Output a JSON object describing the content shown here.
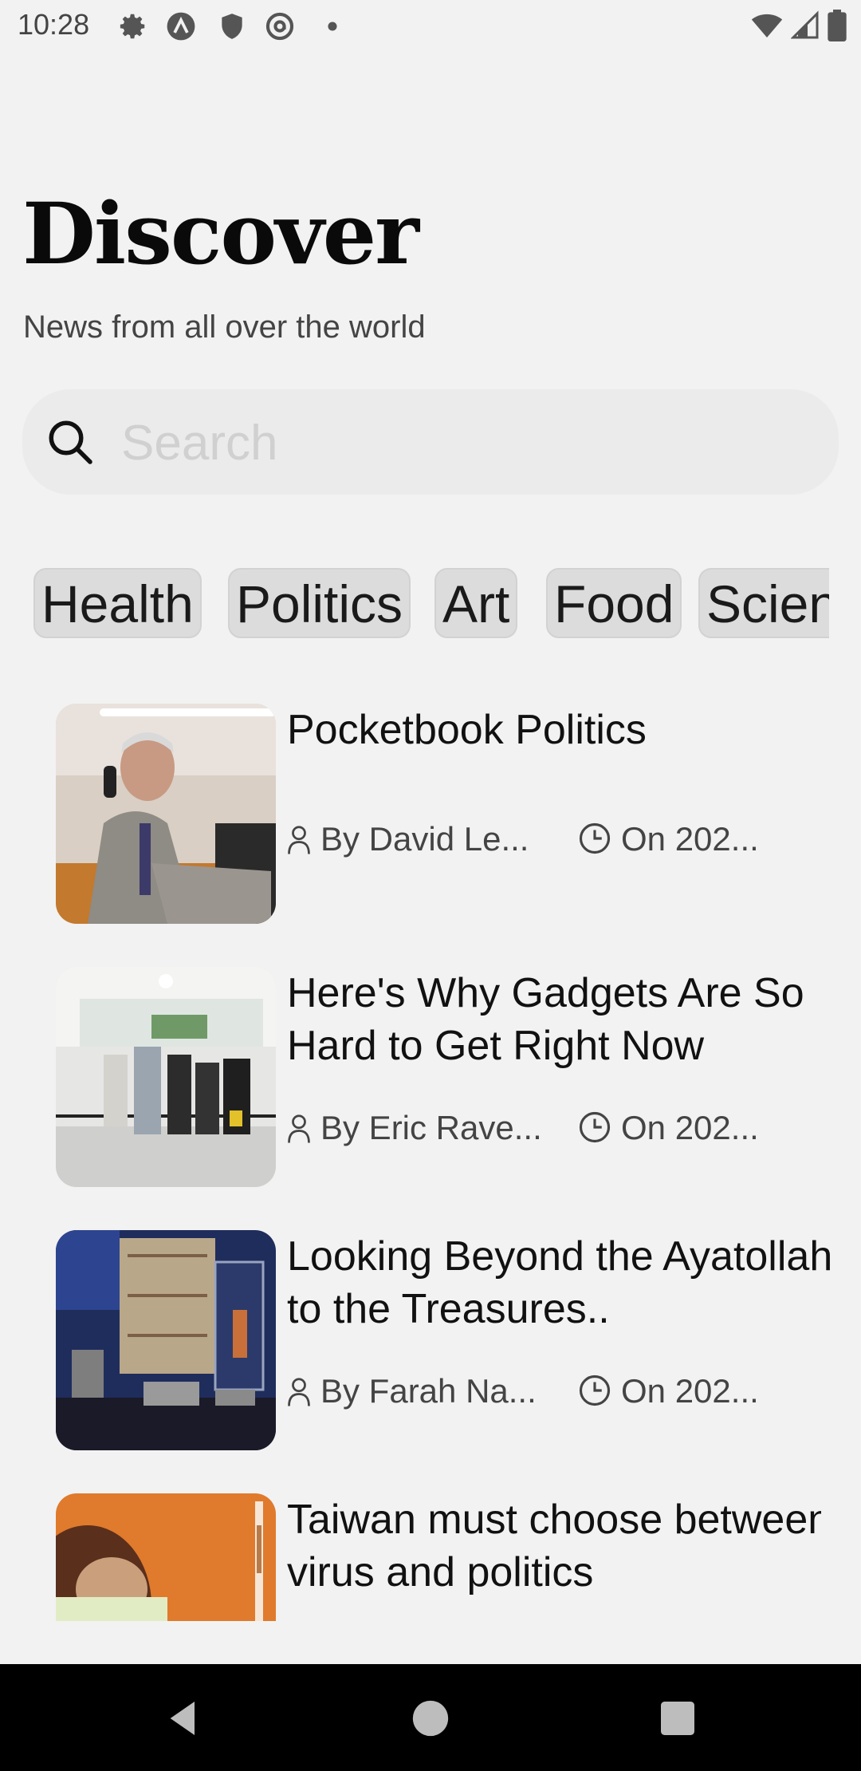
{
  "status_bar": {
    "time": "10:28",
    "left_icons": [
      "gear-icon",
      "app-a-icon",
      "shield-icon",
      "at-sign-icon",
      "dot-icon"
    ],
    "right_icons": [
      "wifi-icon",
      "cell-signal-icon",
      "battery-icon"
    ]
  },
  "header": {
    "title": "Discover",
    "subtitle": "News from all over the world"
  },
  "search": {
    "placeholder": "Search",
    "value": ""
  },
  "categories": [
    "Health",
    "Politics",
    "Art",
    "Food",
    "Scien"
  ],
  "articles": [
    {
      "title": "Pocketbook Politics",
      "author": "By David Le...",
      "date": "On 202..."
    },
    {
      "title": "Here's Why Gadgets Are So Hard to Get Right Now",
      "author": "By Eric Rave...",
      "date": "On 202..."
    },
    {
      "title": "Looking Beyond the Ayatollah to the Treasures..",
      "author": "By Farah Na...",
      "date": "On 202..."
    },
    {
      "title": "Taiwan must choose between virus and politics",
      "author": "",
      "date": ""
    }
  ],
  "nav": [
    "back-icon",
    "home-icon",
    "recents-icon"
  ],
  "colors": {
    "background": "#f2f2f2",
    "chip": "#dcdcdc",
    "search": "#ebebeb"
  }
}
